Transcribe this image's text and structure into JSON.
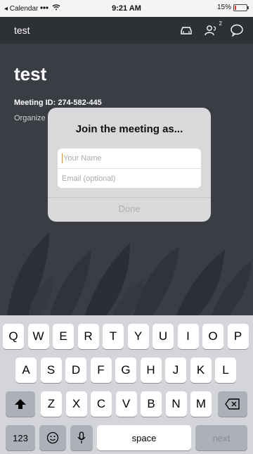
{
  "status_bar": {
    "back_app": "◂ Calendar",
    "time": "9:21 AM",
    "battery": "15%",
    "battery_level": 0.15
  },
  "header": {
    "title": "test",
    "icons": [
      "car-icon",
      "participants-icon",
      "chat-icon"
    ],
    "participant_count": "2"
  },
  "meeting": {
    "title": "test",
    "meeting_id_label": "Meeting ID: 274-582-445",
    "organizer_label": "Organize"
  },
  "dialog": {
    "title": "Join the meeting as...",
    "name_placeholder": "Your Name",
    "email_placeholder": "Email (optional)",
    "done_label": "Done"
  },
  "keyboard": {
    "row1": [
      "Q",
      "W",
      "E",
      "R",
      "T",
      "Y",
      "U",
      "I",
      "O",
      "P"
    ],
    "row2": [
      "A",
      "S",
      "D",
      "F",
      "G",
      "H",
      "J",
      "K",
      "L"
    ],
    "row3": [
      "Z",
      "X",
      "C",
      "V",
      "B",
      "N",
      "M"
    ],
    "num_label": "123",
    "space_label": "space",
    "next_label": "next"
  }
}
